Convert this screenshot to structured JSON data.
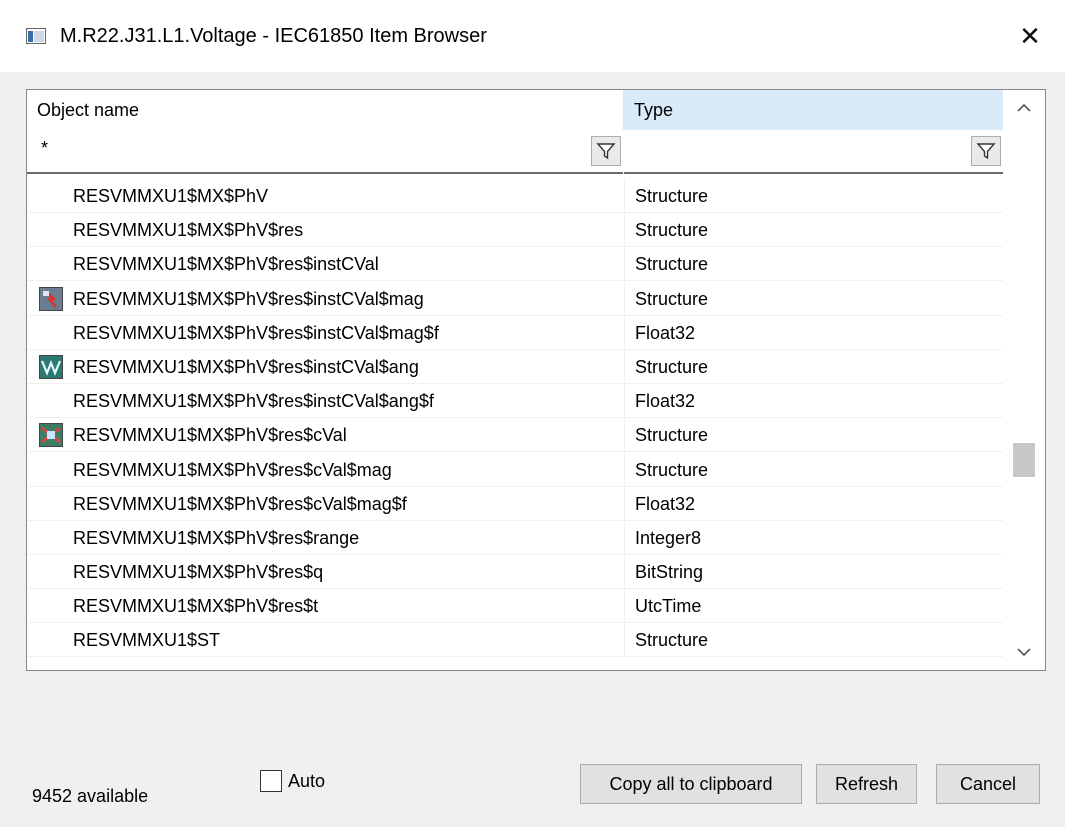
{
  "window": {
    "title": "M.R22.J31.L1.Voltage - IEC61850 Item Browser"
  },
  "columns": {
    "name": "Object name",
    "type": "Type"
  },
  "filters": {
    "name": "*",
    "type": ""
  },
  "rows": [
    {
      "name": "RESVMMXU1$MX$PhV",
      "type": "Structure",
      "icon": ""
    },
    {
      "name": "RESVMMXU1$MX$PhV$res",
      "type": "Structure",
      "icon": ""
    },
    {
      "name": "RESVMMXU1$MX$PhV$res$instCVal",
      "type": "Structure",
      "icon": ""
    },
    {
      "name": "RESVMMXU1$MX$PhV$res$instCVal$mag",
      "type": "Structure",
      "icon": "mag-icon"
    },
    {
      "name": "RESVMMXU1$MX$PhV$res$instCVal$mag$f",
      "type": "Float32",
      "icon": ""
    },
    {
      "name": "RESVMMXU1$MX$PhV$res$instCVal$ang",
      "type": "Structure",
      "icon": "ang-icon"
    },
    {
      "name": "RESVMMXU1$MX$PhV$res$instCVal$ang$f",
      "type": "Float32",
      "icon": ""
    },
    {
      "name": "RESVMMXU1$MX$PhV$res$cVal",
      "type": "Structure",
      "icon": "cval-icon"
    },
    {
      "name": "RESVMMXU1$MX$PhV$res$cVal$mag",
      "type": "Structure",
      "icon": ""
    },
    {
      "name": "RESVMMXU1$MX$PhV$res$cVal$mag$f",
      "type": "Float32",
      "icon": ""
    },
    {
      "name": "RESVMMXU1$MX$PhV$res$range",
      "type": "Integer8",
      "icon": ""
    },
    {
      "name": "RESVMMXU1$MX$PhV$res$q",
      "type": "BitString",
      "icon": ""
    },
    {
      "name": "RESVMMXU1$MX$PhV$res$t",
      "type": "UtcTime",
      "icon": ""
    },
    {
      "name": "RESVMMXU1$ST",
      "type": "Structure",
      "icon": ""
    }
  ],
  "status": {
    "count": "9452 available"
  },
  "auto": {
    "label": "Auto",
    "checked": false
  },
  "buttons": {
    "copy": "Copy all to clipboard",
    "refresh": "Refresh",
    "cancel": "Cancel"
  },
  "colors": {
    "header_selected": "#d9ebf9",
    "button_bg": "#e1e1e1"
  }
}
